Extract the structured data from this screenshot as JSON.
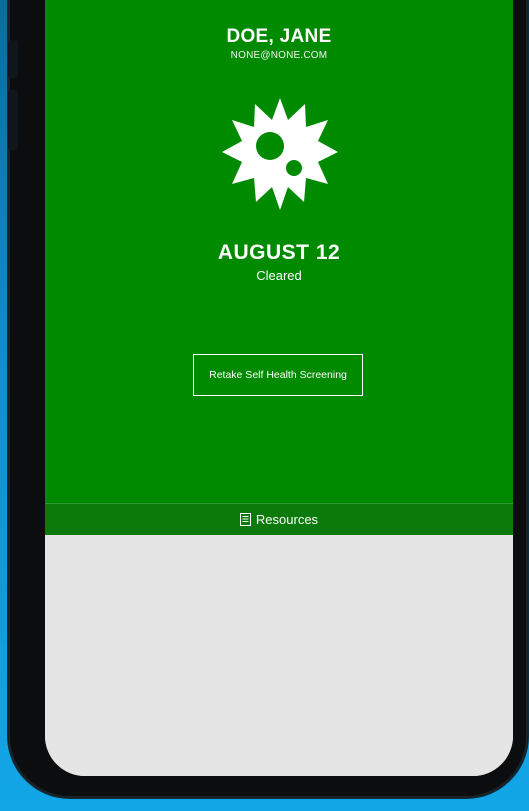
{
  "user": {
    "name": "DOE, JANE",
    "email": "NONE@NONE.COM"
  },
  "status": {
    "date": "AUGUST 12",
    "label": "Cleared",
    "icon": "virus-icon",
    "color": "#008a00"
  },
  "actions": {
    "retake_label": "Retake Self Health Screening"
  },
  "footer": {
    "resources_label": "Resources",
    "resources_icon": "document-icon"
  }
}
